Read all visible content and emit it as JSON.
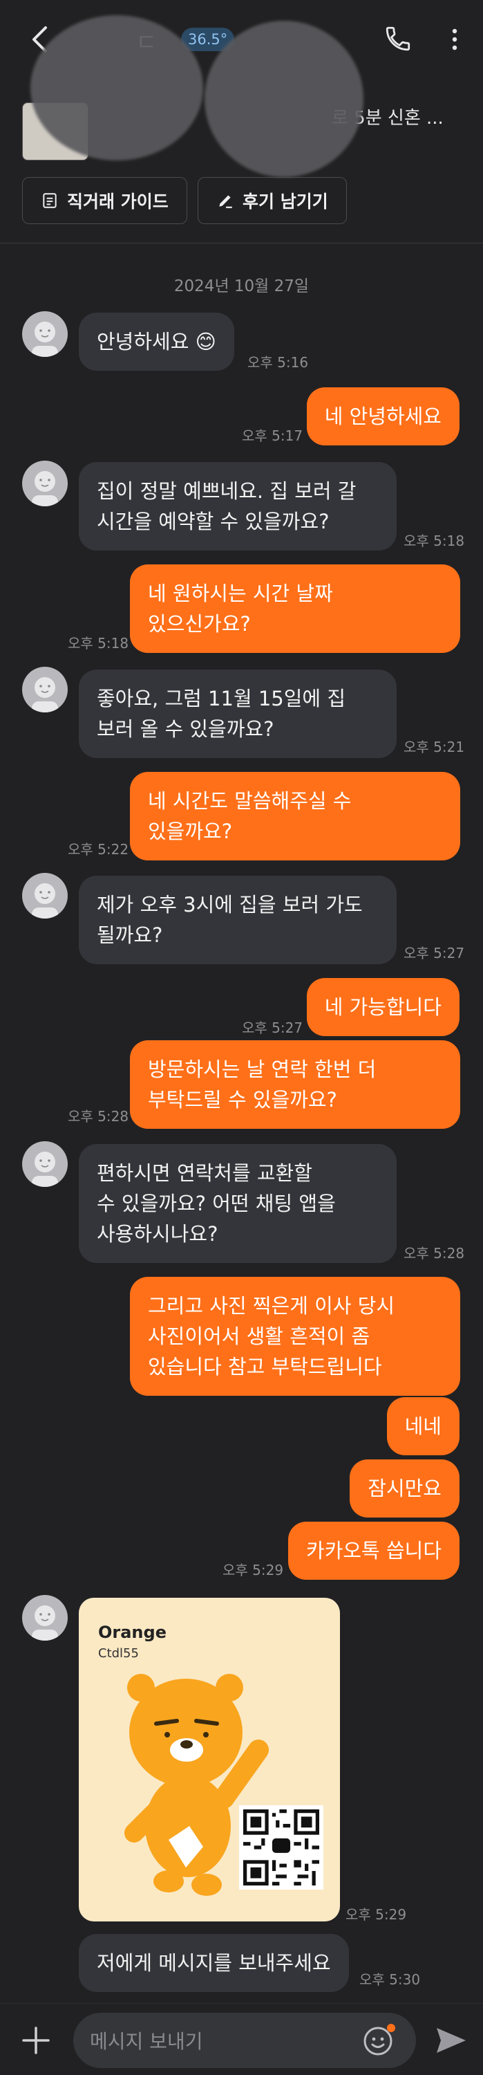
{
  "header": {
    "title_fragment": "ㄷ",
    "temperature": "36.5°"
  },
  "product": {
    "description": "로 5분 신혼 ...",
    "guide_button": "직거래 가이드",
    "review_button": "후기 남기기"
  },
  "date_separator": "2024년 10월 27일",
  "messages": [
    {
      "dir": "in",
      "text": "안녕하세요 😊",
      "time": "오후 5:16"
    },
    {
      "dir": "out",
      "text": "네 안녕하세요",
      "time": "오후 5:17"
    },
    {
      "dir": "in",
      "lines": [
        "집이 정말 예쁘네요. 집 보러 갈",
        "시간을 예약할 수 있을까요?"
      ],
      "time": "오후 5:18"
    },
    {
      "dir": "out",
      "lines": [
        "네 원하시는 시간 날짜",
        "있으신가요?"
      ],
      "time": "오후 5:18"
    },
    {
      "dir": "in",
      "lines": [
        "좋아요, 그럼 11월 15일에 집",
        "보러 올 수 있을까요?"
      ],
      "time": "오후 5:21"
    },
    {
      "dir": "out",
      "lines": [
        "네 시간도 말씀해주실 수",
        "있을까요?"
      ],
      "time": "오후 5:22"
    },
    {
      "dir": "in",
      "lines": [
        "제가 오후 3시에 집을 보러 가도",
        "될까요?"
      ],
      "time": "오후 5:27"
    },
    {
      "dir": "out",
      "text": "네 가능합니다",
      "time": "오후 5:27"
    },
    {
      "dir": "out",
      "lines": [
        "방문하시는 날 연락 한번 더",
        "부탁드릴 수 있을까요?"
      ],
      "time": "오후 5:28"
    },
    {
      "dir": "in",
      "lines": [
        "편하시면 연락처를 교환할",
        "수 있을까요? 어떤 채팅 앱을",
        "사용하시나요?"
      ],
      "time": "오후 5:28"
    },
    {
      "dir": "out",
      "lines": [
        "그리고  사진 찍은게 이사 당시",
        "사진이어서 생활 흔적이 좀",
        "있습니다 참고 부탁드립니다"
      ]
    },
    {
      "dir": "out",
      "text": "네네"
    },
    {
      "dir": "out",
      "text": "잠시만요"
    },
    {
      "dir": "out",
      "text": "카카오톡 씁니다",
      "time": "오후 5:29"
    },
    {
      "dir": "in",
      "card": {
        "title": "Orange",
        "subtitle": "Ctdl55"
      },
      "time": "오후 5:29"
    },
    {
      "dir": "in",
      "text": "저에게 메시지를 보내주세요",
      "time": "오후 5:30"
    }
  ],
  "composer": {
    "placeholder": "메시지 보내기"
  },
  "colors": {
    "background": "#212123",
    "incoming_bubble": "#34353a",
    "outgoing_bubble": "#ff7019",
    "accent_badge": "#2b4a66"
  },
  "icons": [
    "back-arrow-icon",
    "phone-icon",
    "more-vertical-icon",
    "document-icon",
    "pencil-icon",
    "plus-icon",
    "emoji-icon",
    "send-icon"
  ]
}
